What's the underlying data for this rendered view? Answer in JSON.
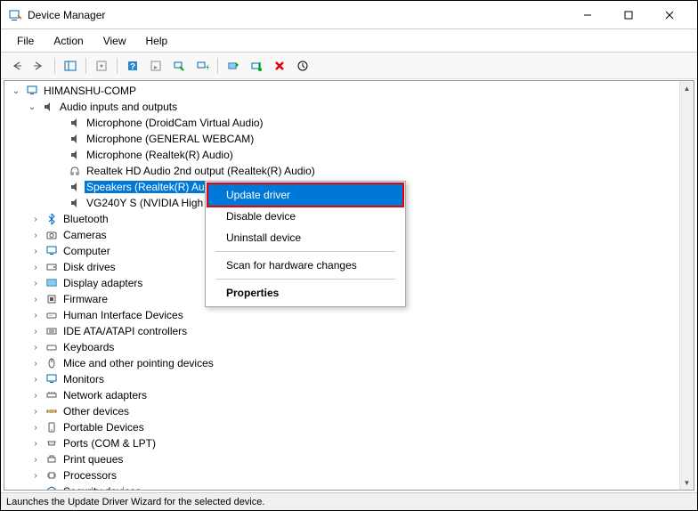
{
  "window": {
    "title": "Device Manager"
  },
  "menubar": [
    "File",
    "Action",
    "View",
    "Help"
  ],
  "tree": {
    "root": "HIMANSHU-COMP",
    "expanded_category": "Audio inputs and outputs",
    "audio_devices": [
      "Microphone (DroidCam Virtual Audio)",
      "Microphone (GENERAL WEBCAM)",
      "Microphone (Realtek(R) Audio)",
      "Realtek HD Audio 2nd output (Realtek(R) Audio)",
      "Speakers (Realtek(R) Audio)",
      "VG240Y S (NVIDIA High D"
    ],
    "selected": "Speakers (Realtek(R) Audio)",
    "categories": [
      "Bluetooth",
      "Cameras",
      "Computer",
      "Disk drives",
      "Display adapters",
      "Firmware",
      "Human Interface Devices",
      "IDE ATA/ATAPI controllers",
      "Keyboards",
      "Mice and other pointing devices",
      "Monitors",
      "Network adapters",
      "Other devices",
      "Portable Devices",
      "Ports (COM & LPT)",
      "Print queues",
      "Processors",
      "Security devices"
    ]
  },
  "context_menu": {
    "items": [
      "Update driver",
      "Disable device",
      "Uninstall device",
      "Scan for hardware changes",
      "Properties"
    ],
    "highlighted": "Update driver"
  },
  "statusbar": "Launches the Update Driver Wizard for the selected device."
}
